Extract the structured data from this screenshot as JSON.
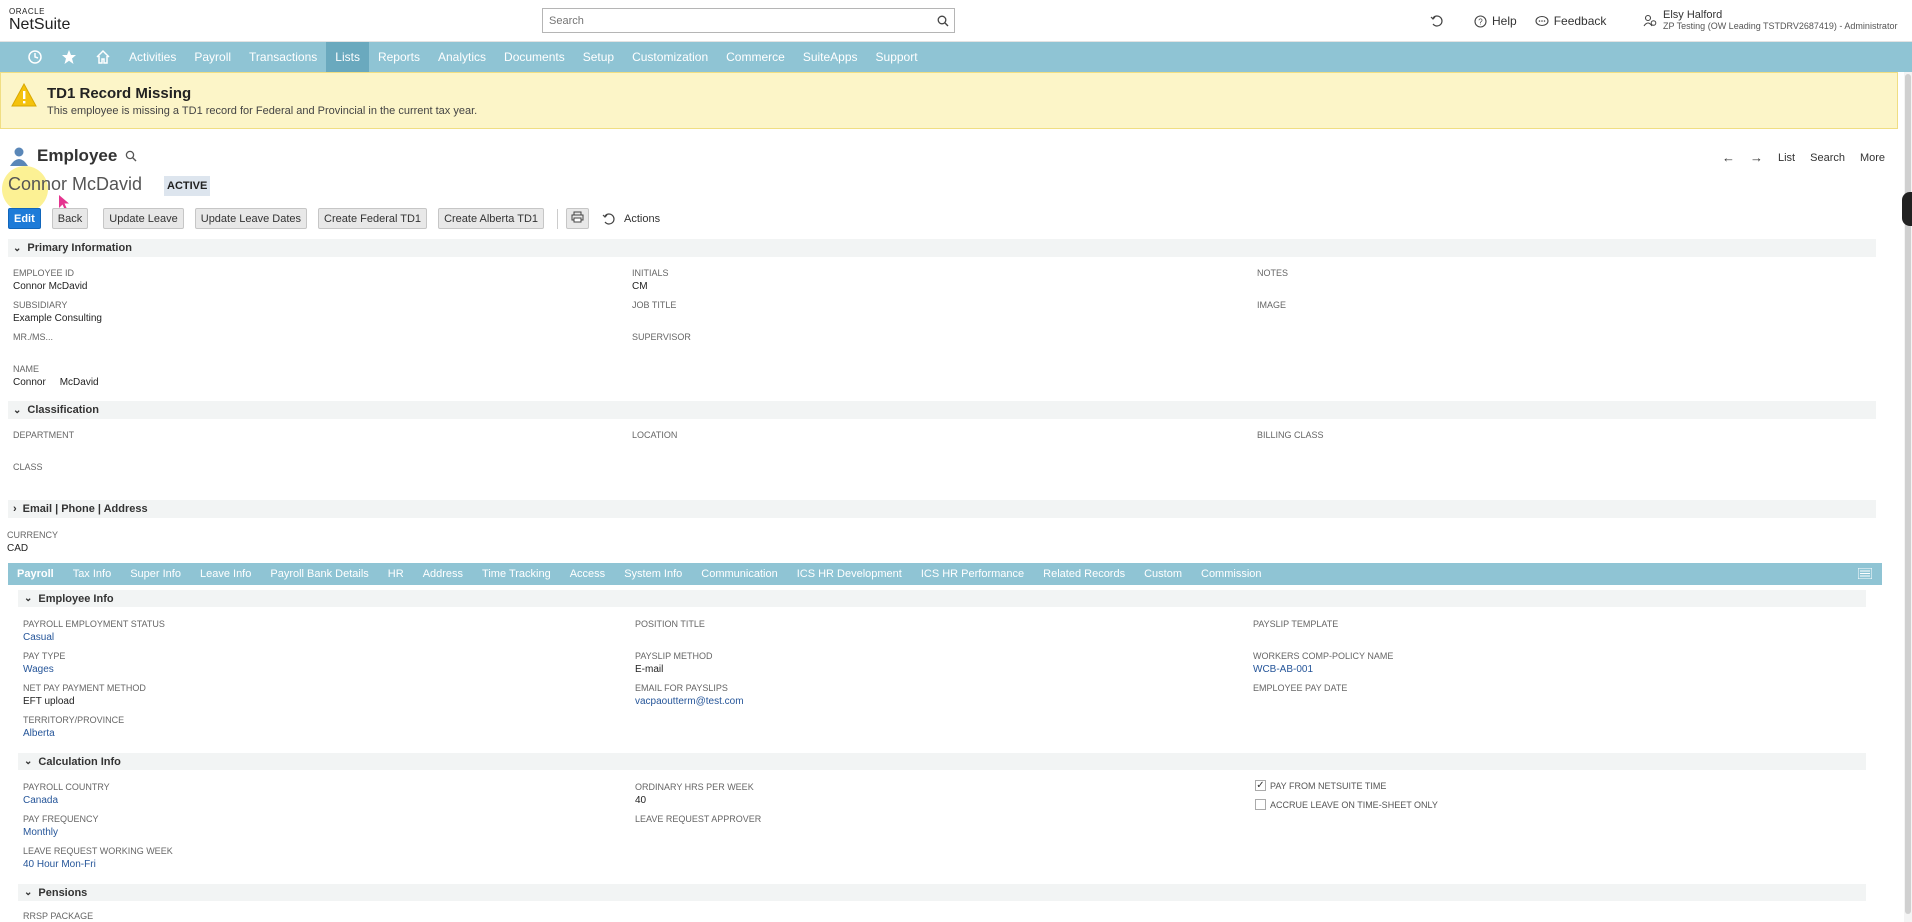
{
  "brand": {
    "oracle": "ORACLE",
    "netsuite": "NetSuite"
  },
  "search": {
    "placeholder": "Search"
  },
  "topbar": {
    "help": "Help",
    "feedback": "Feedback",
    "user_name": "Elsy Halford",
    "user_role": "ZP Testing (OW Leading TSTDRV2687419) - Administrator"
  },
  "nav": {
    "items": [
      "Activities",
      "Payroll",
      "Transactions",
      "Lists",
      "Reports",
      "Analytics",
      "Documents",
      "Setup",
      "Customization",
      "Commerce",
      "SuiteApps",
      "Support"
    ],
    "active": "Lists"
  },
  "alert": {
    "title": "TD1 Record Missing",
    "message": "This employee is missing a TD1 record for Federal and Provincial in the current tax year."
  },
  "page": {
    "type": "Employee",
    "record_name": "Connor McDavid",
    "status": "ACTIVE"
  },
  "page_nav": {
    "list": "List",
    "search": "Search",
    "more": "More"
  },
  "buttons": {
    "edit": "Edit",
    "back": "Back",
    "update_leave": "Update Leave",
    "update_leave_dates": "Update Leave Dates",
    "create_federal_td1": "Create Federal TD1",
    "create_alberta_td1": "Create Alberta TD1",
    "actions": "Actions"
  },
  "primary": {
    "title": "Primary Information",
    "employee_id_label": "EMPLOYEE ID",
    "employee_id": "Connor McDavid",
    "subsidiary_label": "SUBSIDIARY",
    "subsidiary": "Example Consulting",
    "mrms_label": "MR./MS...",
    "name_label": "NAME",
    "first_name": "Connor",
    "last_name": "McDavid",
    "initials_label": "INITIALS",
    "initials": "CM",
    "job_title_label": "JOB TITLE",
    "supervisor_label": "SUPERVISOR",
    "notes_label": "NOTES",
    "image_label": "IMAGE"
  },
  "classification": {
    "title": "Classification",
    "department_label": "DEPARTMENT",
    "class_label": "CLASS",
    "location_label": "LOCATION",
    "billing_class_label": "BILLING CLASS"
  },
  "contact": {
    "title": "Email | Phone | Address"
  },
  "currency": {
    "label": "CURRENCY",
    "value": "CAD"
  },
  "tabs": {
    "items": [
      "Payroll",
      "Tax Info",
      "Super Info",
      "Leave Info",
      "Payroll Bank Details",
      "HR",
      "Address",
      "Time Tracking",
      "Access",
      "System Info",
      "Communication",
      "ICS HR Development",
      "ICS HR Performance",
      "Related Records",
      "Custom",
      "Commission"
    ],
    "active": "Payroll"
  },
  "employee_info": {
    "title": "Employee Info",
    "status_label": "PAYROLL EMPLOYMENT STATUS",
    "status": "Casual",
    "pay_type_label": "PAY TYPE",
    "pay_type": "Wages",
    "net_pay_label": "NET PAY PAYMENT METHOD",
    "net_pay": "EFT upload",
    "territory_label": "TERRITORY/PROVINCE",
    "territory": "Alberta",
    "position_label": "POSITION TITLE",
    "payslip_method_label": "PAYSLIP METHOD",
    "payslip_method": "E-mail",
    "email_label": "EMAIL FOR PAYSLIPS",
    "email": "vacpaoutterm@test.com",
    "payslip_template_label": "PAYSLIP TEMPLATE",
    "workers_comp_label": "WORKERS COMP-POLICY NAME",
    "workers_comp": "WCB-AB-001",
    "pay_date_label": "EMPLOYEE PAY DATE"
  },
  "calc_info": {
    "title": "Calculation Info",
    "country_label": "PAYROLL COUNTRY",
    "country": "Canada",
    "frequency_label": "PAY FREQUENCY",
    "frequency": "Monthly",
    "working_week_label": "LEAVE REQUEST WORKING WEEK",
    "working_week": "40 Hour Mon-Fri",
    "hours_label": "ORDINARY HRS PER WEEK",
    "hours": "40",
    "approver_label": "LEAVE REQUEST APPROVER",
    "pay_from_time_label": "PAY FROM NETSUITE TIME",
    "pay_from_time_checked": true,
    "accrue_label": "ACCRUE LEAVE ON TIME-SHEET ONLY",
    "accrue_checked": false
  },
  "pensions": {
    "title": "Pensions",
    "rrsp_label": "RRSP PACKAGE"
  }
}
